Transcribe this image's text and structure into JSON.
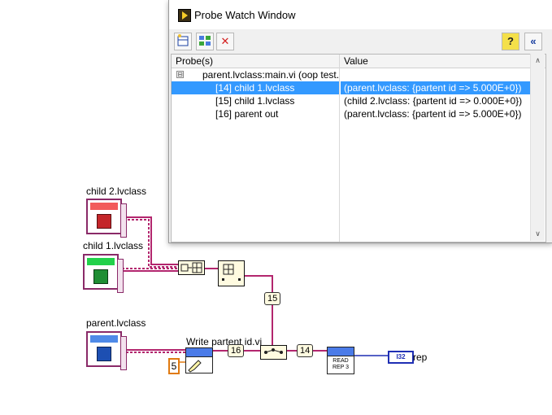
{
  "probe_window": {
    "title": "Probe Watch Window",
    "toolbar": {
      "icons": [
        "probe-display-icon",
        "reorder-probes-icon",
        "delete-probe-icon",
        "help-icon",
        "collapse-icon"
      ]
    },
    "columns": {
      "probe": "Probe(s)",
      "value": "Value"
    },
    "rows": [
      {
        "probe": "parent.lvclass:main.vi (oop test.",
        "value": "",
        "expander": "⊟"
      },
      {
        "probe": "[14] child 1.lvclass",
        "value": "(parent.lvclass: {partent id => 5.000E+0})",
        "selected": true
      },
      {
        "probe": "[15] child 1.lvclass",
        "value": "(child 2.lvclass: {partent id => 0.000E+0})"
      },
      {
        "probe": "[16] parent out",
        "value": "(parent.lvclass: {partent id => 5.000E+0})"
      }
    ]
  },
  "diagram": {
    "labels": {
      "child2": "child 2.lvclass",
      "child1": "child 1.lvclass",
      "parent": "parent.lvclass",
      "write_vi": "Write partent id.vi",
      "rep": "rep"
    },
    "constant": "5",
    "probe_tags": {
      "p15": "15",
      "p16": "16",
      "p14": "14"
    },
    "read_vi": {
      "line1": "READ",
      "line2": "REP 3"
    },
    "indicator": "I32",
    "colors": {
      "class_wire": "#b3266e",
      "int_wire": "#1f2fb4",
      "vi_header": "#4b7be8",
      "selection": "#3399ff"
    }
  }
}
